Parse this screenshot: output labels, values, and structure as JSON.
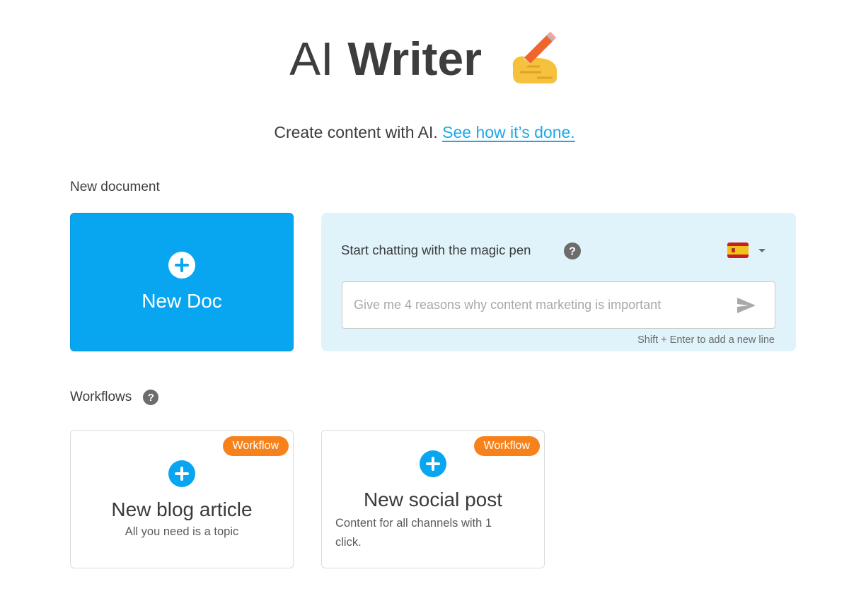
{
  "header": {
    "title_light": "AI",
    "title_bold": "Writer",
    "title_icon": "writing-hand-emoji"
  },
  "subtitle": {
    "text": "Create content with AI.",
    "link": "See how it’s done."
  },
  "new_document": {
    "section_label": "New document",
    "new_doc_label": "New Doc"
  },
  "chat": {
    "title": "Start chatting with the magic pen",
    "help_icon": "question-circle-icon",
    "language_flag": "spain-flag-icon",
    "input_value": "",
    "input_placeholder": "Give me 4 reasons why content marketing is important",
    "send_icon": "send-icon",
    "hint": "Shift + Enter to add a new line"
  },
  "workflows": {
    "section_label": "Workflows",
    "help_icon": "question-circle-icon",
    "cards": [
      {
        "badge": "Workflow",
        "title": "New blog article",
        "description": "All you need is a topic"
      },
      {
        "badge": "Workflow",
        "title": "New social post",
        "description": "Content for all channels with 1 click."
      }
    ]
  },
  "colors": {
    "accent_blue": "#08a6f0",
    "link_blue": "#1ea7e9",
    "chat_panel_bg": "#e0f3fb",
    "badge_orange": "#f7821b",
    "text_dark": "#3c3c3c"
  }
}
